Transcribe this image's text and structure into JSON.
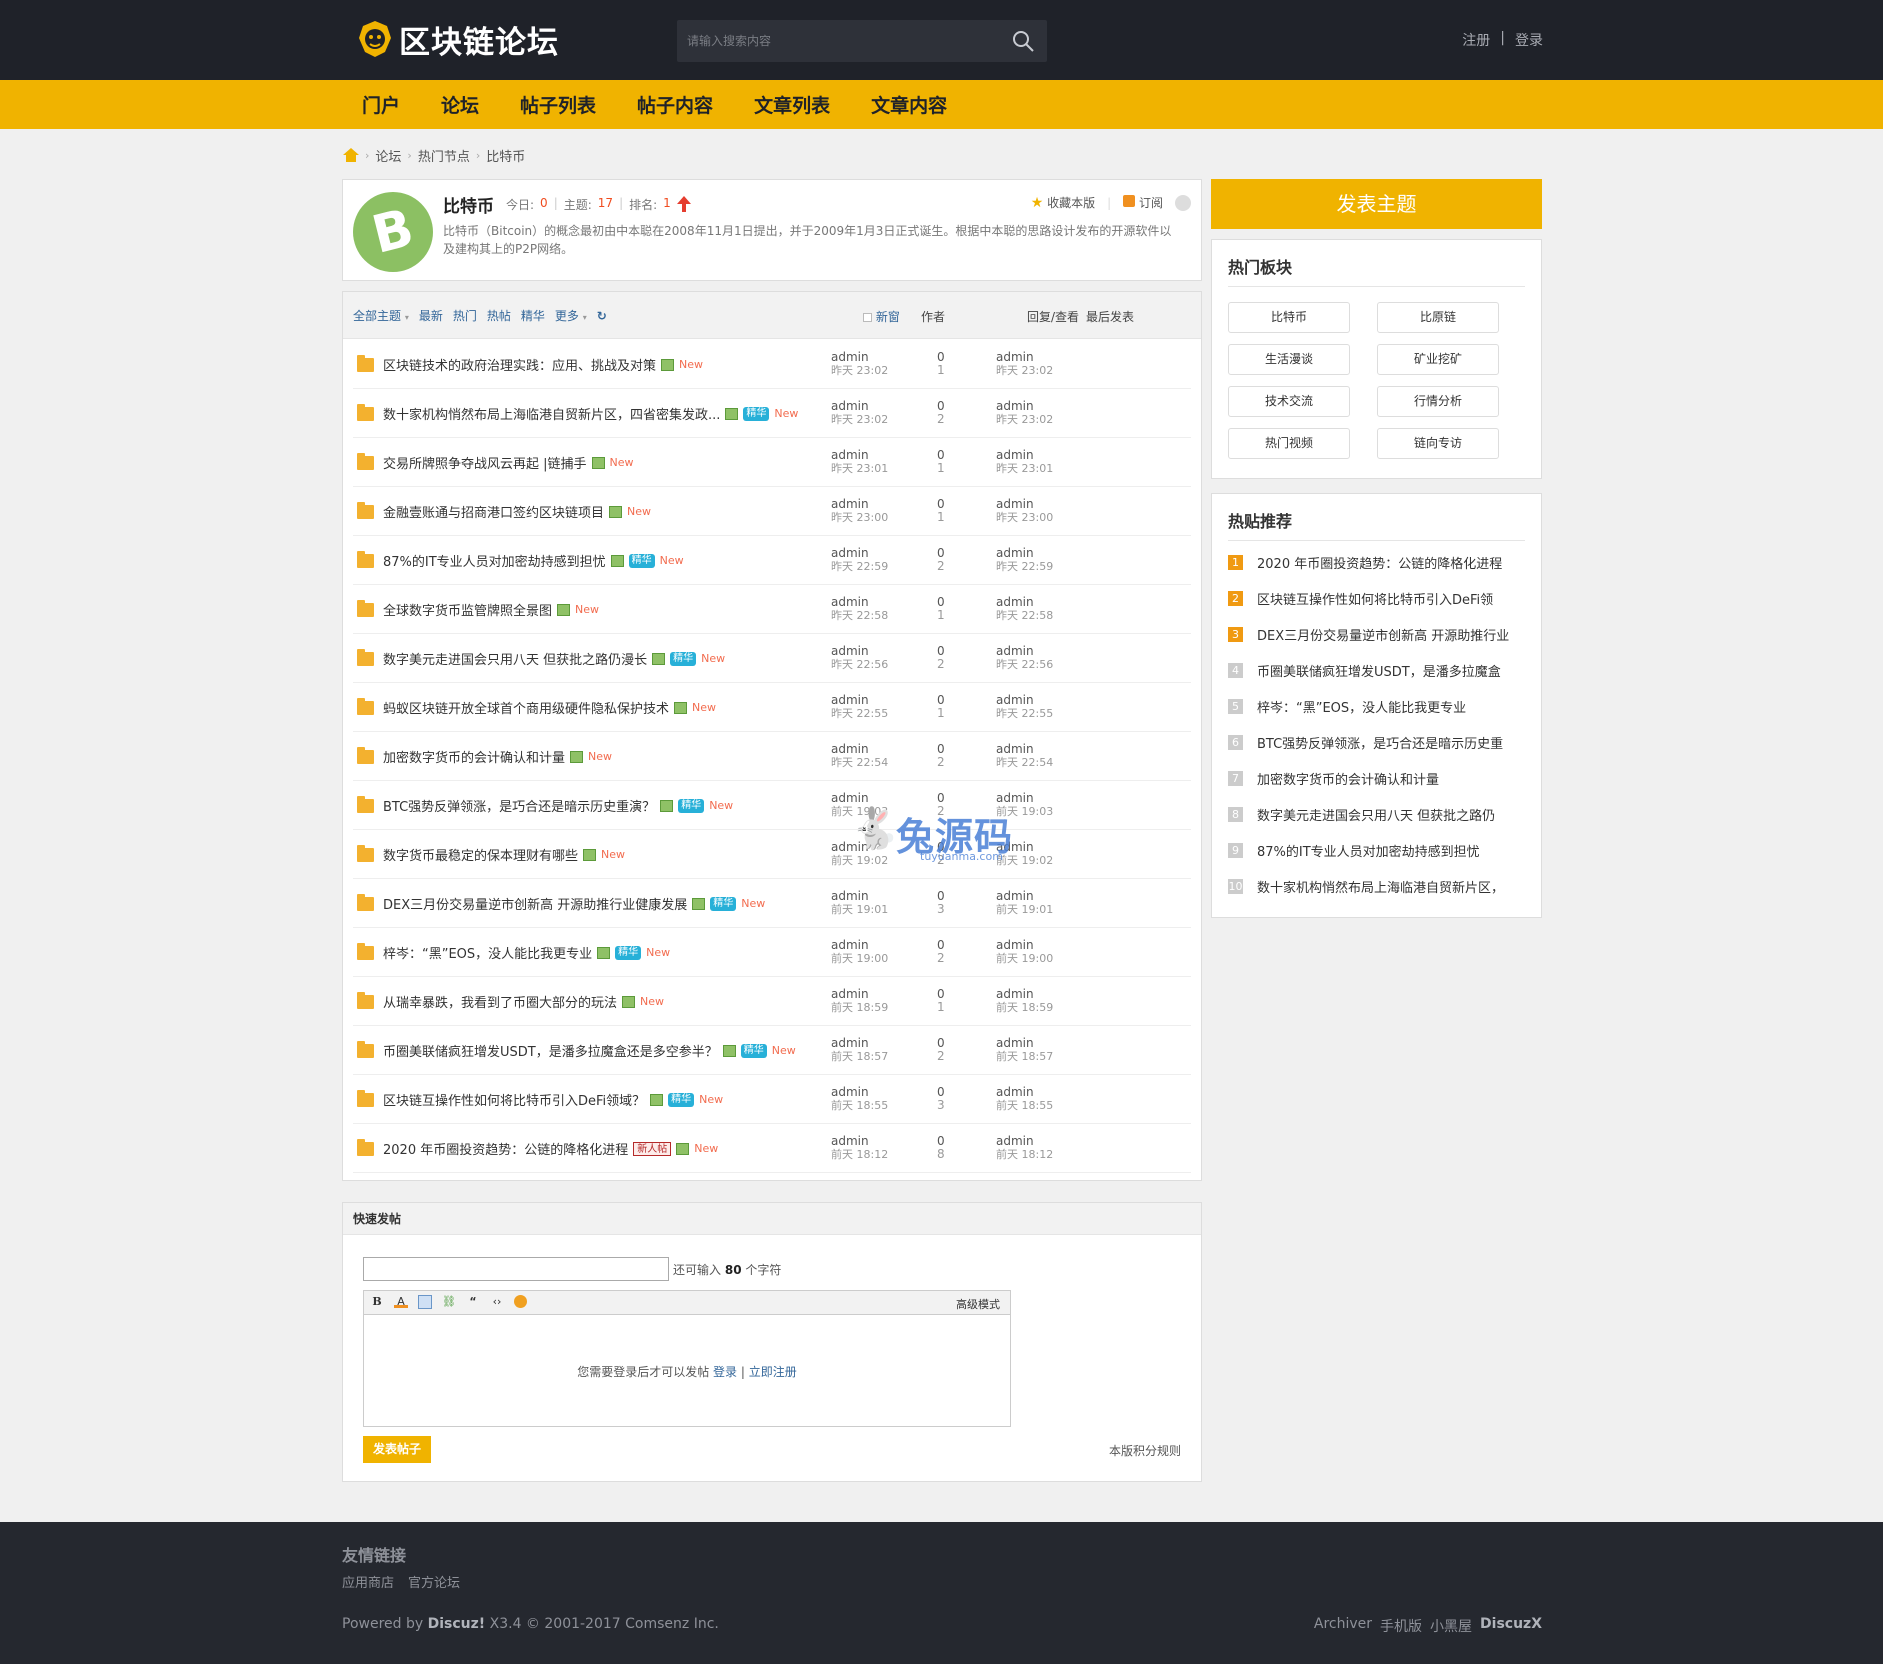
{
  "header": {
    "logo_text": "区块链论坛",
    "search_placeholder": "请输入搜索内容",
    "register": "注册",
    "divider": "|",
    "login": "登录"
  },
  "nav": [
    "门户",
    "论坛",
    "帖子列表",
    "帖子内容",
    "文章列表",
    "文章内容"
  ],
  "breadcrumb": [
    "论坛",
    "热门节点",
    "比特币"
  ],
  "forum": {
    "icon_glyph": "B",
    "title": "比特币",
    "today_label": "今日:",
    "today_value": "0",
    "topics_label": "主题:",
    "topics_value": "17",
    "rank_label": "排名:",
    "rank_value": "1",
    "description": "比特币（Bitcoin）的概念最初由中本聪在2008年11月1日提出，并于2009年1月3日正式诞生。根据中本聪的思路设计发布的开源软件以及建构其上的P2P网络。",
    "favorite": "收藏本版",
    "subscribe": "订阅"
  },
  "list": {
    "filters": [
      "全部主题",
      "最新",
      "热门",
      "热帖",
      "精华",
      "更多"
    ],
    "new_window": "新窗",
    "col_author": "作者",
    "col_replies": "回复/查看",
    "col_last": "最后发表",
    "jing_label": "精华",
    "xin_label": "新人帖",
    "new_label": "New",
    "threads": [
      {
        "title": "区块链技术的政府治理实践：应用、挑战及对策",
        "author": "admin",
        "date": "昨天 23:02",
        "replies": "0",
        "views": "1",
        "last_author": "admin",
        "last_date": "昨天 23:02",
        "jing": false,
        "xin": false
      },
      {
        "title": "数十家机构悄然布局上海临港自贸新片区，四省密集发政...",
        "author": "admin",
        "date": "昨天 23:02",
        "replies": "0",
        "views": "2",
        "last_author": "admin",
        "last_date": "昨天 23:02",
        "jing": true,
        "xin": false
      },
      {
        "title": "交易所牌照争夺战风云再起 |链捕手",
        "author": "admin",
        "date": "昨天 23:01",
        "replies": "0",
        "views": "1",
        "last_author": "admin",
        "last_date": "昨天 23:01",
        "jing": false,
        "xin": false
      },
      {
        "title": "金融壹账通与招商港口签约区块链项目",
        "author": "admin",
        "date": "昨天 23:00",
        "replies": "0",
        "views": "1",
        "last_author": "admin",
        "last_date": "昨天 23:00",
        "jing": false,
        "xin": false
      },
      {
        "title": "87%的IT专业人员对加密劫持感到担忧",
        "author": "admin",
        "date": "昨天 22:59",
        "replies": "0",
        "views": "2",
        "last_author": "admin",
        "last_date": "昨天 22:59",
        "jing": true,
        "xin": false
      },
      {
        "title": "全球数字货币监管牌照全景图",
        "author": "admin",
        "date": "昨天 22:58",
        "replies": "0",
        "views": "1",
        "last_author": "admin",
        "last_date": "昨天 22:58",
        "jing": false,
        "xin": false
      },
      {
        "title": "数字美元走进国会只用八天 但获批之路仍漫长",
        "author": "admin",
        "date": "昨天 22:56",
        "replies": "0",
        "views": "2",
        "last_author": "admin",
        "last_date": "昨天 22:56",
        "jing": true,
        "xin": false
      },
      {
        "title": "蚂蚁区块链开放全球首个商用级硬件隐私保护技术",
        "author": "admin",
        "date": "昨天 22:55",
        "replies": "0",
        "views": "1",
        "last_author": "admin",
        "last_date": "昨天 22:55",
        "jing": false,
        "xin": false
      },
      {
        "title": "加密数字货币的会计确认和计量",
        "author": "admin",
        "date": "昨天 22:54",
        "replies": "0",
        "views": "2",
        "last_author": "admin",
        "last_date": "昨天 22:54",
        "jing": false,
        "xin": false
      },
      {
        "title": "BTC强势反弹领涨，是巧合还是暗示历史重演？",
        "author": "admin",
        "date": "前天 19:03",
        "replies": "0",
        "views": "2",
        "last_author": "admin",
        "last_date": "前天 19:03",
        "jing": true,
        "xin": false
      },
      {
        "title": "数字货币最稳定的保本理财有哪些",
        "author": "admin",
        "date": "前天 19:02",
        "replies": "0",
        "views": "2",
        "last_author": "admin",
        "last_date": "前天 19:02",
        "jing": false,
        "xin": false
      },
      {
        "title": "DEX三月份交易量逆市创新高 开源助推行业健康发展",
        "author": "admin",
        "date": "前天 19:01",
        "replies": "0",
        "views": "3",
        "last_author": "admin",
        "last_date": "前天 19:01",
        "jing": true,
        "xin": false
      },
      {
        "title": "梓岑：“黑”EOS，没人能比我更专业",
        "author": "admin",
        "date": "前天 19:00",
        "replies": "0",
        "views": "2",
        "last_author": "admin",
        "last_date": "前天 19:00",
        "jing": true,
        "xin": false
      },
      {
        "title": "从瑞幸暴跌，我看到了币圈大部分的玩法",
        "author": "admin",
        "date": "前天 18:59",
        "replies": "0",
        "views": "1",
        "last_author": "admin",
        "last_date": "前天 18:59",
        "jing": false,
        "xin": false
      },
      {
        "title": "币圈美联储疯狂增发USDT，是潘多拉魔盒还是多空参半？",
        "author": "admin",
        "date": "前天 18:57",
        "replies": "0",
        "views": "2",
        "last_author": "admin",
        "last_date": "前天 18:57",
        "jing": true,
        "xin": false
      },
      {
        "title": "区块链互操作性如何将比特币引入DeFi领域？",
        "author": "admin",
        "date": "前天 18:55",
        "replies": "0",
        "views": "3",
        "last_author": "admin",
        "last_date": "前天 18:55",
        "jing": true,
        "xin": false
      },
      {
        "title": "2020 年币圈投资趋势：公链的降格化进程",
        "author": "admin",
        "date": "前天 18:12",
        "replies": "0",
        "views": "8",
        "last_author": "admin",
        "last_date": "前天 18:12",
        "jing": false,
        "xin": true
      }
    ]
  },
  "quickpost": {
    "title": "快速发帖",
    "remaining_prefix": "还可输入",
    "remaining_value": "80",
    "remaining_suffix": "个字符",
    "toolbar": [
      "B",
      "A"
    ],
    "advanced": "高级模式",
    "login_msg": "您需要登录后才可以发帖",
    "login_link": "登录",
    "sep": "|",
    "register_link": "立即注册",
    "post_button": "发表帖子",
    "rules": "本版积分规则"
  },
  "sidebar": {
    "new_topic": "发表主题",
    "hot_boards_title": "热门板块",
    "boards": [
      "比特币",
      "比原链",
      "生活漫谈",
      "矿业挖矿",
      "技术交流",
      "行情分析",
      "热门视频",
      "链向专访"
    ],
    "hot_posts_title": "热贴推荐",
    "hot_posts": [
      "2020 年币圈投资趋势：公链的降格化进程",
      "区块链互操作性如何将比特币引入DeFi领",
      "DEX三月份交易量逆市创新高 开源助推行业",
      "币圈美联储疯狂增发USDT，是潘多拉魔盒",
      "梓岑：“黑”EOS，没人能比我更专业",
      "BTC强势反弹领涨，是巧合还是暗示历史重",
      "加密数字货币的会计确认和计量",
      "数字美元走进国会只用八天 但获批之路仍",
      "87%的IT专业人员对加密劫持感到担忧",
      "数十家机构悄然布局上海临港自贸新片区，"
    ]
  },
  "watermark": {
    "text": "兔源码",
    "sub": "tuyuanma.com"
  },
  "footer": {
    "links_title": "友情链接",
    "links": [
      "应用商店",
      "官方论坛"
    ],
    "powered_prefix": "Powered by",
    "powered_brand": "Discuz!",
    "powered_suffix": "X3.4  © 2001-2017 Comsenz Inc.",
    "right_links": [
      "Archiver",
      "手机版",
      "小黑屋"
    ],
    "right_brand": "DiscuzX"
  },
  "colors": {
    "accent": "#f0b300",
    "topbar": "#1f2229",
    "footer": "#25282f",
    "new": "#f26c4f"
  }
}
